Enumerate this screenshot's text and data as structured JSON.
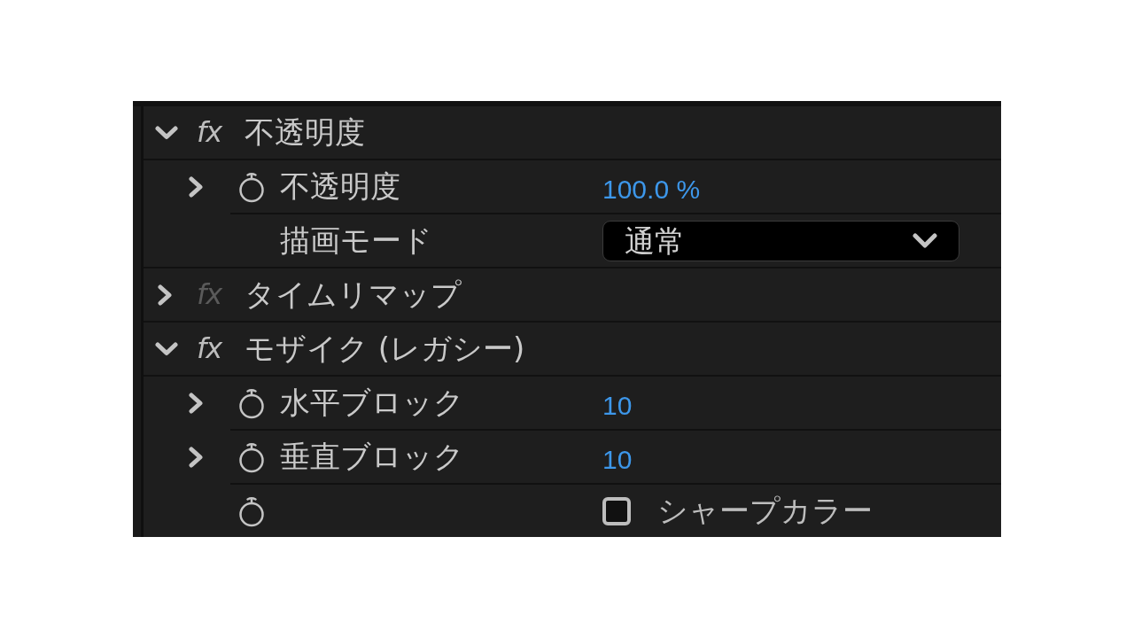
{
  "effects": [
    {
      "name": "不透明度",
      "fx": "fx",
      "expanded": true,
      "enabled": true,
      "properties": [
        {
          "kind": "numeric",
          "name": "不透明度",
          "value": "100.0 %",
          "expanded": false
        },
        {
          "kind": "dropdown",
          "name": "描画モード",
          "value": "通常"
        }
      ]
    },
    {
      "name": "タイムリマップ",
      "fx": "fx",
      "expanded": false,
      "enabled": false
    },
    {
      "name": "モザイク (レガシー)",
      "fx": "fx",
      "expanded": true,
      "enabled": true,
      "properties": [
        {
          "kind": "numeric",
          "name": "水平ブロック",
          "value": "10",
          "expanded": false
        },
        {
          "kind": "numeric",
          "name": "垂直ブロック",
          "value": "10",
          "expanded": false
        },
        {
          "kind": "checkbox",
          "label": "シャープカラー",
          "checked": false
        }
      ]
    }
  ]
}
